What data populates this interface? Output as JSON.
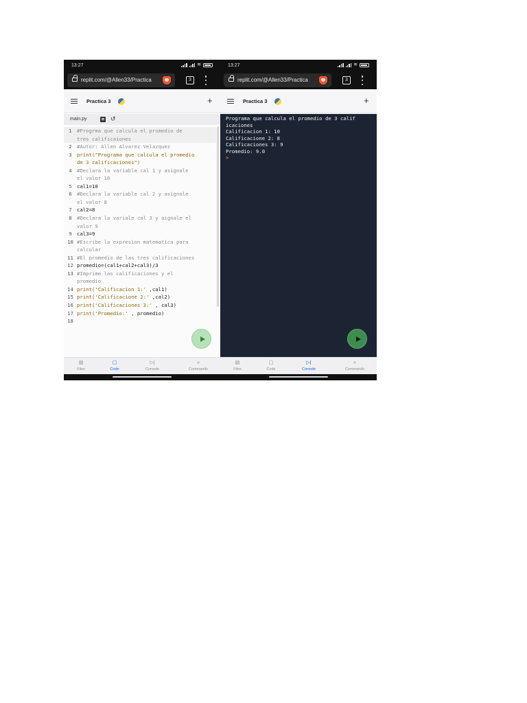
{
  "left_phone": {
    "status": {
      "time": "13:27",
      "battery": "100"
    },
    "browser": {
      "url": "replit.com/@Allen33/Practica",
      "tab_count": "3"
    },
    "app": {
      "title": "Practica 3"
    },
    "editor": {
      "file_tab": "main.py",
      "lines": [
        {
          "n": "1",
          "parts": [
            {
              "t": "#Progrma que calcula el promedio de",
              "c": "c-com"
            }
          ]
        },
        {
          "n": "",
          "parts": [
            {
              "t": "tres calificaiones",
              "c": "c-com"
            }
          ]
        },
        {
          "n": "2",
          "parts": [
            {
              "t": "#Autor: Allen Alvarez Velazquez",
              "c": "c-com"
            }
          ]
        },
        {
          "n": "3",
          "parts": [
            {
              "t": "print(",
              "c": "c-fn"
            },
            {
              "t": "\"Programa que calcula el promedio",
              "c": "c-str"
            }
          ]
        },
        {
          "n": "",
          "parts": [
            {
              "t": "de 3 calificaciones\"",
              "c": "c-str"
            },
            {
              "t": ")",
              "c": "c-fn"
            }
          ]
        },
        {
          "n": "4",
          "parts": [
            {
              "t": "#Declara la variable cal 1 y asignale",
              "c": "c-com"
            }
          ]
        },
        {
          "n": "",
          "parts": [
            {
              "t": "el valor 10",
              "c": "c-com"
            }
          ]
        },
        {
          "n": "5",
          "parts": [
            {
              "t": "cal1=10",
              "c": "c-plain"
            }
          ]
        },
        {
          "n": "6",
          "parts": [
            {
              "t": "#Declara la variable cal 2 y asignale",
              "c": "c-com"
            }
          ]
        },
        {
          "n": "",
          "parts": [
            {
              "t": "el valor 8",
              "c": "c-com"
            }
          ]
        },
        {
          "n": "7",
          "parts": [
            {
              "t": "cal2=8",
              "c": "c-plain"
            }
          ]
        },
        {
          "n": "8",
          "parts": [
            {
              "t": "#Declara la variale cal 3 y aignale el",
              "c": "c-com"
            }
          ]
        },
        {
          "n": "",
          "parts": [
            {
              "t": "valor 9",
              "c": "c-com"
            }
          ]
        },
        {
          "n": "9",
          "parts": [
            {
              "t": "cal3=9",
              "c": "c-plain"
            }
          ]
        },
        {
          "n": "10",
          "parts": [
            {
              "t": "#Escribe la expresion matematica para",
              "c": "c-com"
            }
          ]
        },
        {
          "n": "",
          "parts": [
            {
              "t": "calcular",
              "c": "c-com"
            }
          ]
        },
        {
          "n": "11",
          "parts": [
            {
              "t": "#El promedio de las tres calificaciones",
              "c": "c-com"
            }
          ]
        },
        {
          "n": "12",
          "parts": [
            {
              "t": "promedio=(cal1+cal2+cal3)/3",
              "c": "c-plain"
            }
          ]
        },
        {
          "n": "13",
          "parts": [
            {
              "t": "#Imprime las calificaciones y el",
              "c": "c-com"
            }
          ]
        },
        {
          "n": "",
          "parts": [
            {
              "t": "promedio",
              "c": "c-com"
            }
          ]
        },
        {
          "n": "14",
          "parts": [
            {
              "t": "print(",
              "c": "c-fn"
            },
            {
              "t": "'Calificacion 1:'",
              "c": "c-str"
            },
            {
              "t": " ,cal1)",
              "c": "c-plain"
            }
          ]
        },
        {
          "n": "15",
          "parts": [
            {
              "t": "print(",
              "c": "c-fn"
            },
            {
              "t": "'Calificacione 2:'",
              "c": "c-str"
            },
            {
              "t": " ,cal2)",
              "c": "c-plain"
            }
          ]
        },
        {
          "n": "16",
          "parts": [
            {
              "t": "print(",
              "c": "c-fn"
            },
            {
              "t": "'Calificaciones 3:'",
              "c": "c-str"
            },
            {
              "t": " , cal3)",
              "c": "c-plain"
            }
          ]
        },
        {
          "n": "17",
          "parts": [
            {
              "t": "print(",
              "c": "c-fn"
            },
            {
              "t": "'Promedio:'",
              "c": "c-str"
            },
            {
              "t": " , promedio)",
              "c": "c-plain"
            }
          ]
        },
        {
          "n": "18",
          "parts": [
            {
              "t": "",
              "c": "c-plain"
            }
          ]
        }
      ]
    },
    "nav": [
      {
        "icon": "files-icon",
        "glyph": "▤",
        "label": "Files",
        "active": false
      },
      {
        "icon": "code-icon",
        "glyph": "▢",
        "label": "Code",
        "active": true
      },
      {
        "icon": "console-icon",
        "glyph": "▷|",
        "label": "Console",
        "active": false
      },
      {
        "icon": "commands-icon",
        "glyph": "»",
        "label": "Commands",
        "active": false
      }
    ]
  },
  "right_phone": {
    "status": {
      "time": "13:27",
      "battery": "100"
    },
    "browser": {
      "url": "replit.com/@Allen33/Practica",
      "tab_count": "3"
    },
    "app": {
      "title": "Practica 3"
    },
    "console": {
      "output": "Programa que calcula el promedio de 3 calif\nicaciones\nCalificacion 1: 10\nCalificacione 2: 8\nCalificaciones 3: 9\nPromedio: 9.0",
      "prompt": ">"
    },
    "nav": [
      {
        "icon": "files-icon",
        "glyph": "▤",
        "label": "Files",
        "active": false
      },
      {
        "icon": "code-icon",
        "glyph": "▢",
        "label": "Code",
        "active": false
      },
      {
        "icon": "console-icon",
        "glyph": "▷|",
        "label": "Console",
        "active": true
      },
      {
        "icon": "commands-icon",
        "glyph": "»",
        "label": "Commands",
        "active": false
      }
    ]
  },
  "colors": {
    "accent": "#0f62fe",
    "console_bg": "#1c2333",
    "run_button_dark": "#3d8d4f",
    "run_button_light": "#b7e2b9"
  }
}
